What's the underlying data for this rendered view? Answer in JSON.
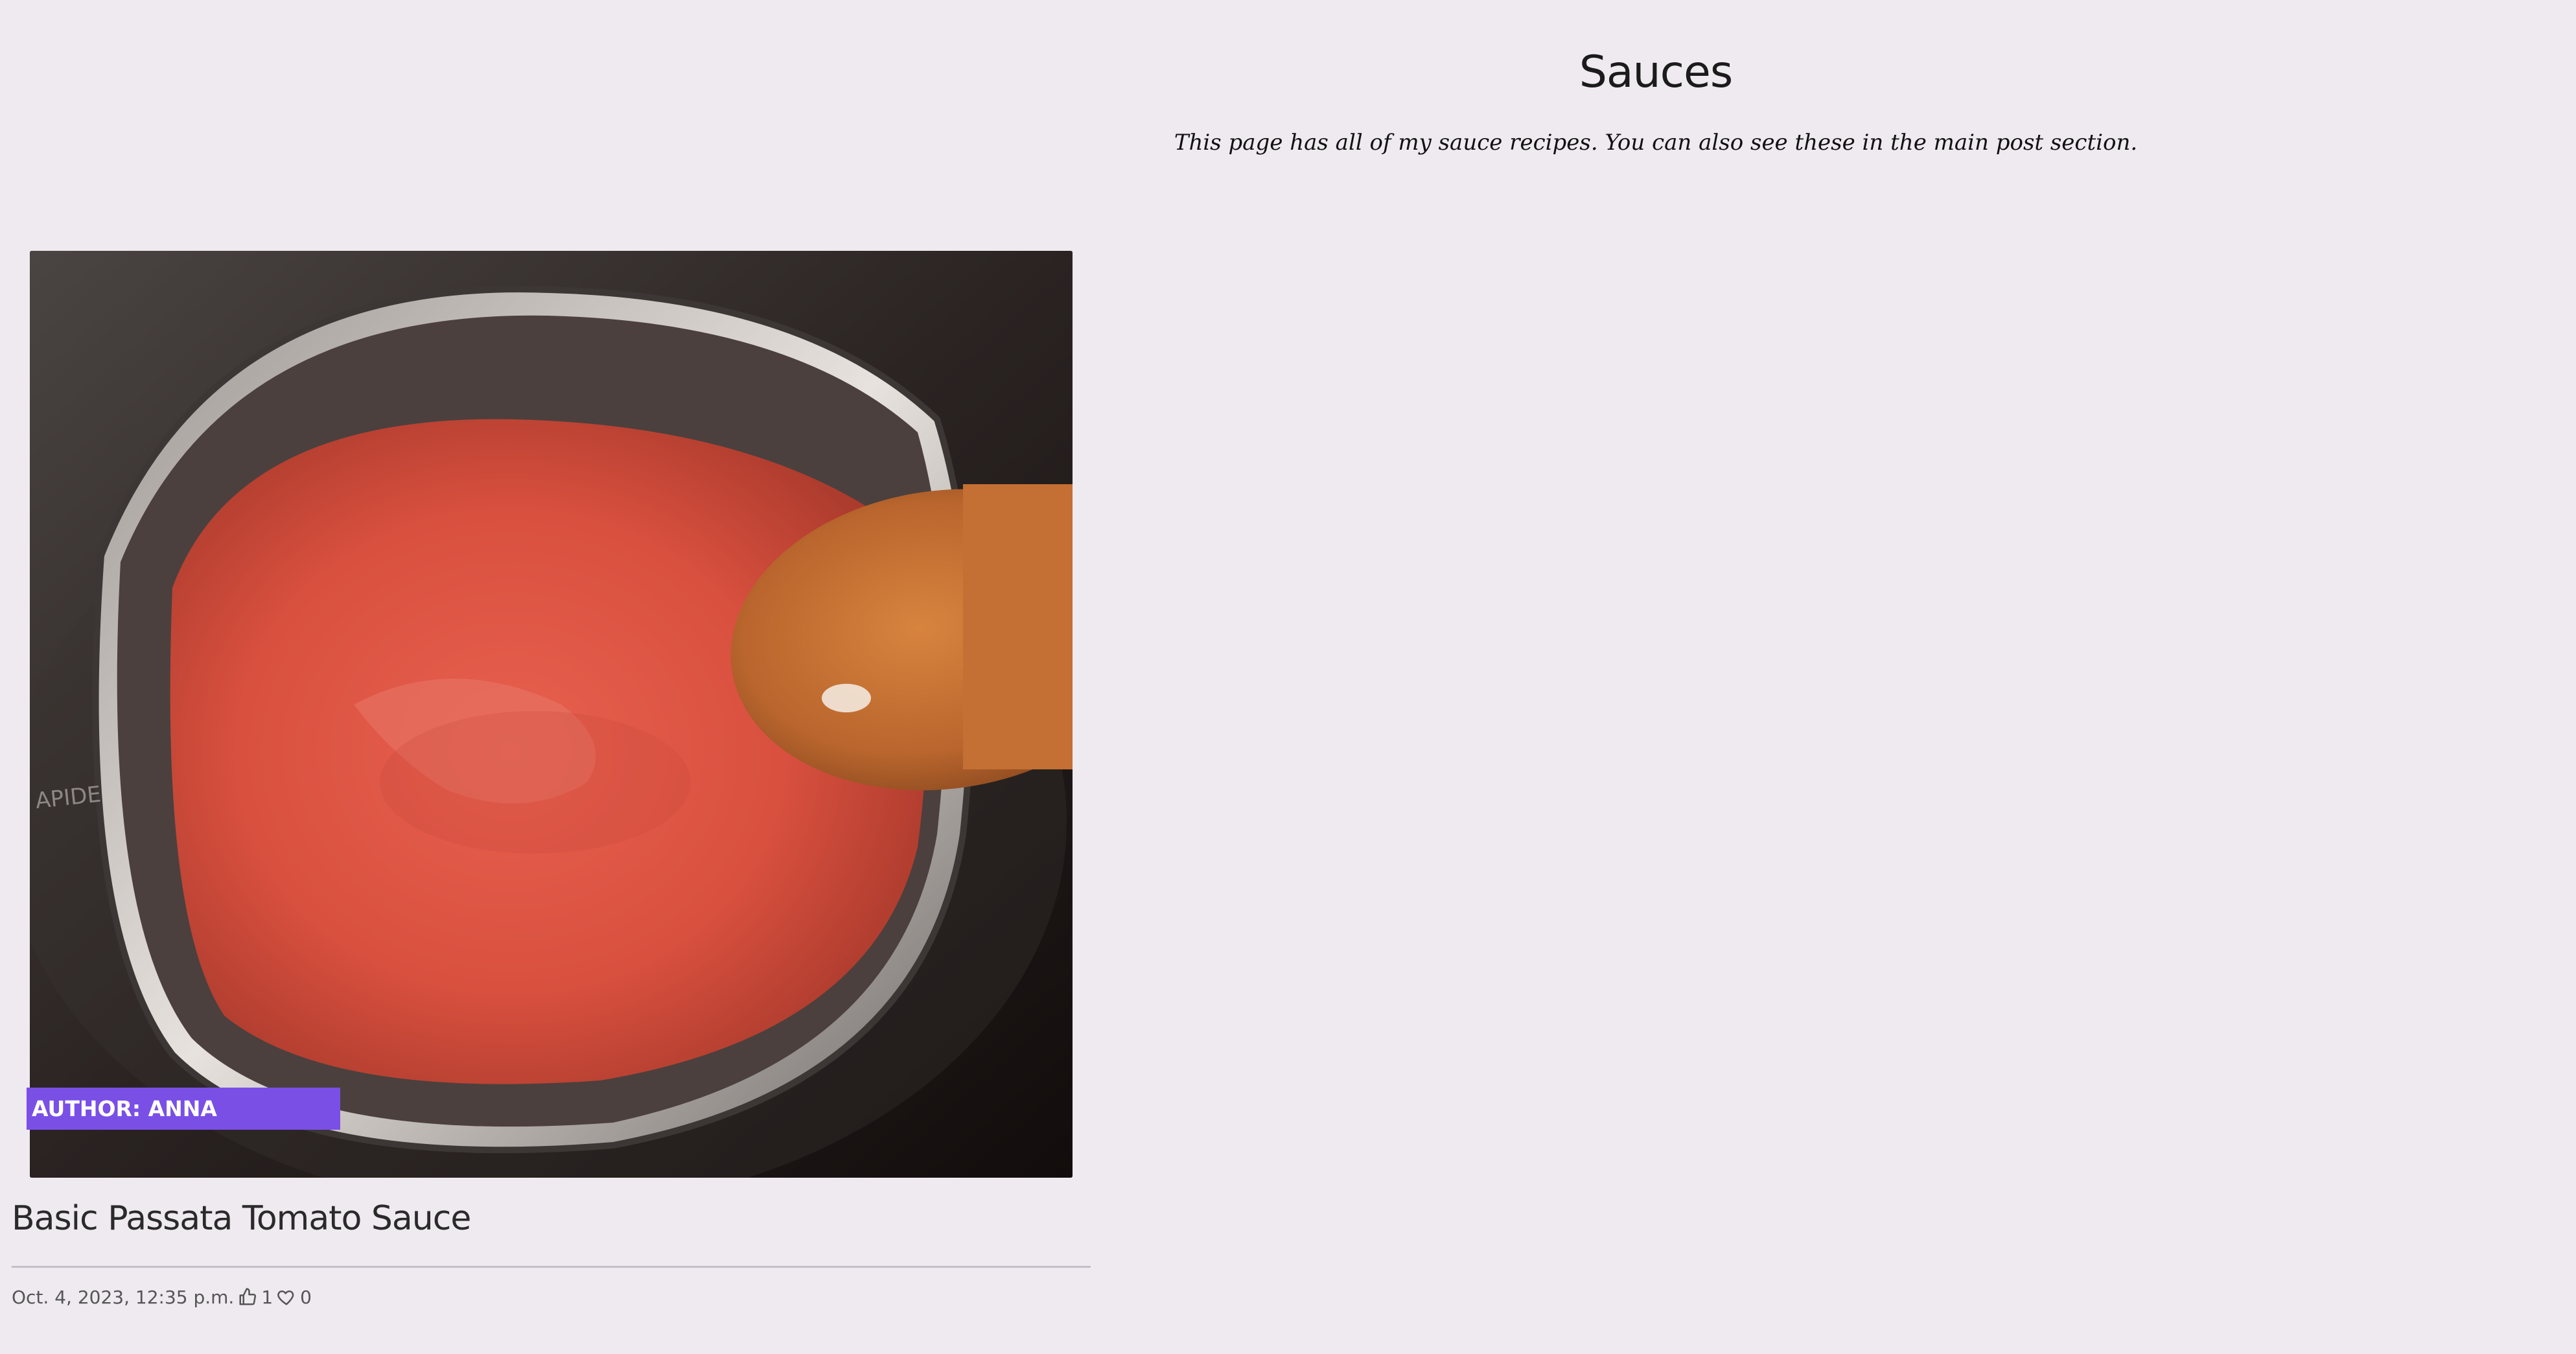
{
  "page": {
    "title": "Sauces",
    "description": "This page has all of my sauce recipes. You can also see these in the main post section."
  },
  "posts": [
    {
      "image_alt": "Tomato sauce in a pan with a wooden spoon",
      "author_badge": "AUTHOR: ANNA",
      "title": "Basic Passata Tomato Sauce",
      "date": "Oct. 4, 2023, 12:35 p.m.",
      "likes": "1",
      "favorites": "0",
      "like_icon": "thumbs-up-icon",
      "favorite_icon": "heart-icon"
    }
  ],
  "colors": {
    "background": "#efe9f0",
    "author_badge": "#7a4fe6",
    "divider": "#c4bec6"
  }
}
